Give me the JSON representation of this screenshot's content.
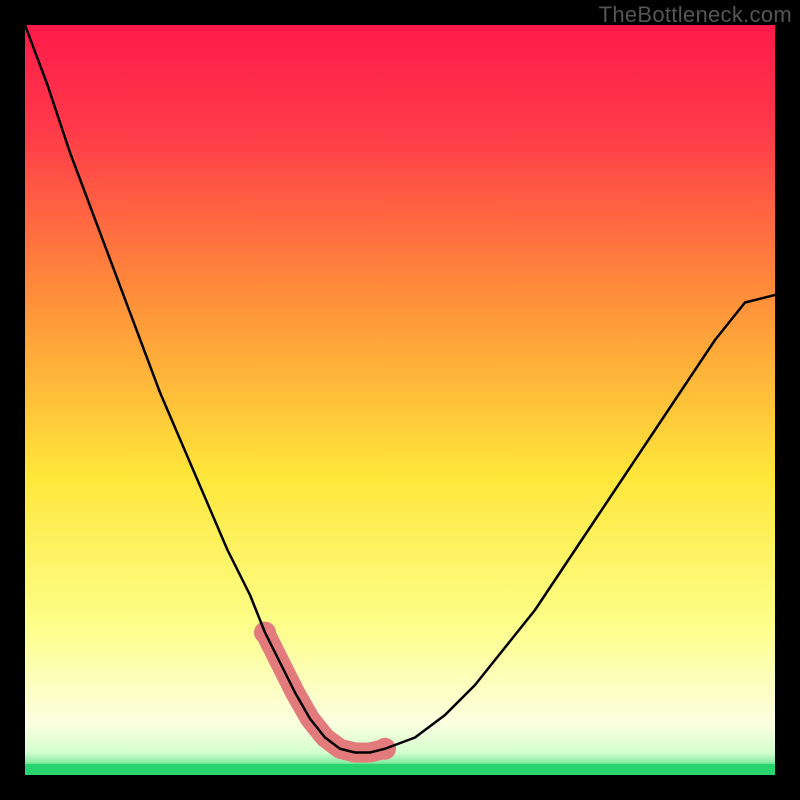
{
  "watermark": "TheBottleneck.com",
  "chart_data": {
    "type": "line",
    "title": "",
    "xlabel": "",
    "ylabel": "",
    "xlim": [
      0,
      100
    ],
    "ylim": [
      0,
      100
    ],
    "series": [
      {
        "name": "curve",
        "x": [
          0,
          3,
          6,
          9,
          12,
          15,
          18,
          21,
          24,
          27,
          30,
          32,
          34,
          36,
          38,
          40,
          42,
          44,
          46,
          48,
          52,
          56,
          60,
          64,
          68,
          72,
          76,
          80,
          84,
          88,
          92,
          96,
          100
        ],
        "y": [
          100,
          92,
          83,
          75,
          67,
          59,
          51,
          44,
          37,
          30,
          24,
          19,
          15,
          11,
          7.5,
          5,
          3.5,
          3,
          3,
          3.5,
          5,
          8,
          12,
          17,
          22,
          28,
          34,
          40,
          46,
          52,
          58,
          63,
          64
        ],
        "color": "#000000",
        "thickness": 2.5
      },
      {
        "name": "highlight",
        "x": [
          32,
          34,
          36,
          38,
          40,
          42,
          44,
          46,
          48
        ],
        "y": [
          19,
          15,
          11,
          7.5,
          5,
          3.5,
          3,
          3,
          3.5
        ],
        "color": "#e37b7d",
        "thickness": 20
      }
    ],
    "background_gradient": [
      "#ff1a4a",
      "#ff8a3a",
      "#ffe63a",
      "#fcffc4",
      "#28d46e"
    ],
    "thin_green_band": {
      "color": "#28d46e",
      "y_fraction": 0.015
    }
  }
}
